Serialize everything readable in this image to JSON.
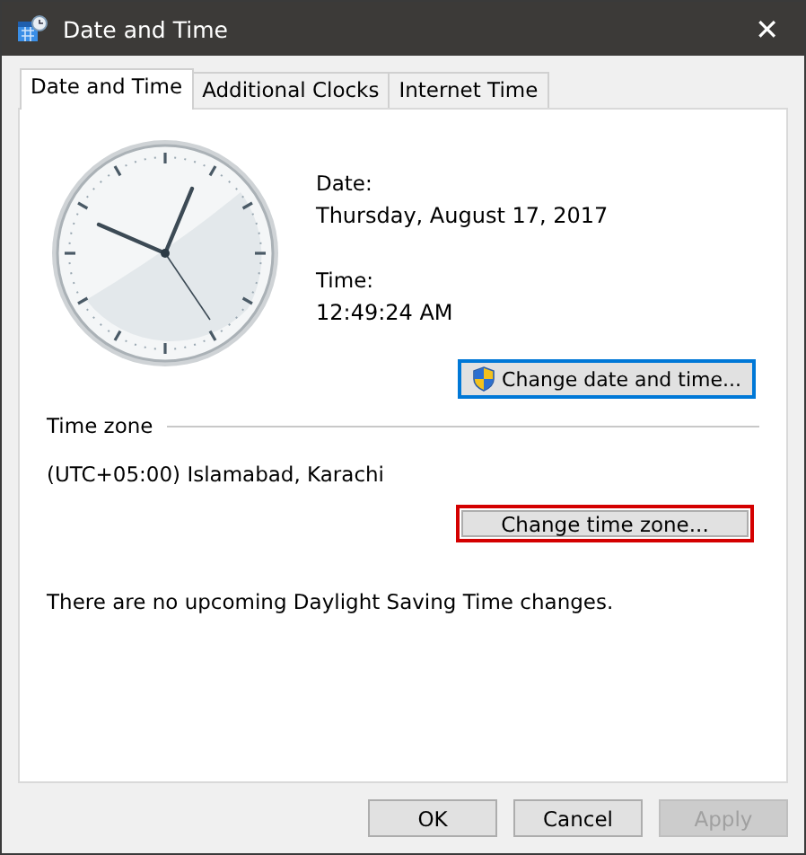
{
  "window": {
    "title": "Date and Time",
    "close": "✕"
  },
  "tabs": [
    {
      "label": "Date and Time",
      "selected": true
    },
    {
      "label": "Additional Clocks",
      "selected": false
    },
    {
      "label": "Internet Time",
      "selected": false
    }
  ],
  "date": {
    "label": "Date:",
    "value": "Thursday, August 17, 2017"
  },
  "time": {
    "label": "Time:",
    "value": "12:49:24 AM"
  },
  "change_date_button": {
    "label": "Change date and time...",
    "focused": true,
    "highlighted": false
  },
  "time_zone": {
    "heading": "Time zone",
    "value": "(UTC+05:00) Islamabad, Karachi"
  },
  "change_zone_button": {
    "label": "Change time zone...",
    "focused": false,
    "highlighted": true
  },
  "dst_note": "There are no upcoming Daylight Saving Time changes.",
  "buttons": [
    {
      "label": "OK",
      "disabled": false
    },
    {
      "label": "Cancel",
      "disabled": false
    },
    {
      "label": "Apply",
      "disabled": true
    }
  ]
}
